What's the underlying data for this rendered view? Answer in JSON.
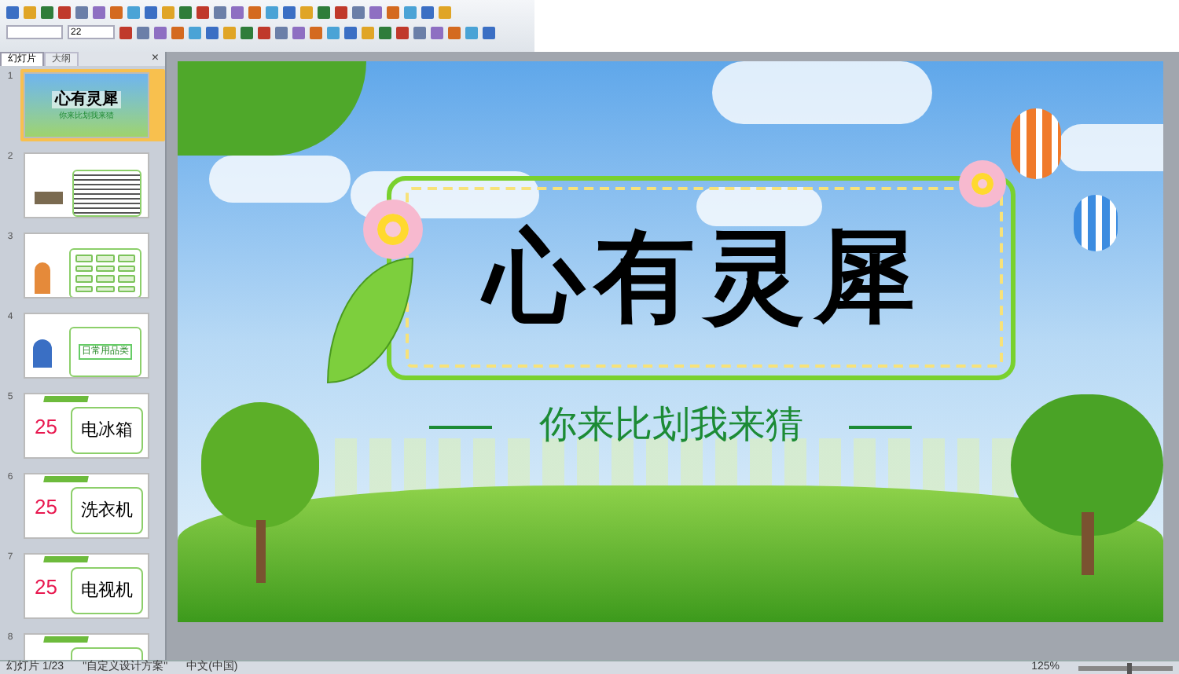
{
  "toolbar": {
    "font_size": "22"
  },
  "panel_tabs": [
    {
      "label": "幻灯片",
      "selected": true
    },
    {
      "label": "大纲",
      "selected": false
    }
  ],
  "panel_close": "×",
  "thumbnails": [
    {
      "number": "1",
      "selected": true,
      "kind": "title",
      "title": "心有灵犀",
      "subtitle": "你来比划我来猜"
    },
    {
      "number": "2",
      "selected": false,
      "kind": "rules"
    },
    {
      "number": "3",
      "selected": false,
      "kind": "grid"
    },
    {
      "number": "4",
      "selected": false,
      "kind": "category",
      "title": "日常用品类"
    },
    {
      "number": "5",
      "selected": false,
      "kind": "word",
      "count": "25",
      "title": "电冰箱"
    },
    {
      "number": "6",
      "selected": false,
      "kind": "word",
      "count": "25",
      "title": "洗衣机"
    },
    {
      "number": "7",
      "selected": false,
      "kind": "word",
      "count": "25",
      "title": "电视机"
    },
    {
      "number": "8",
      "selected": false,
      "kind": "word"
    }
  ],
  "slide": {
    "title": "心有灵犀",
    "subtitle": "你来比划我来猜"
  },
  "status_bar": {
    "slide_count": "幻灯片 1/23",
    "theme": "\"自定义设计方案\"",
    "language": "中文(中国)",
    "zoom": "125%",
    "zoom_slider": {
      "level": 0.55
    }
  }
}
